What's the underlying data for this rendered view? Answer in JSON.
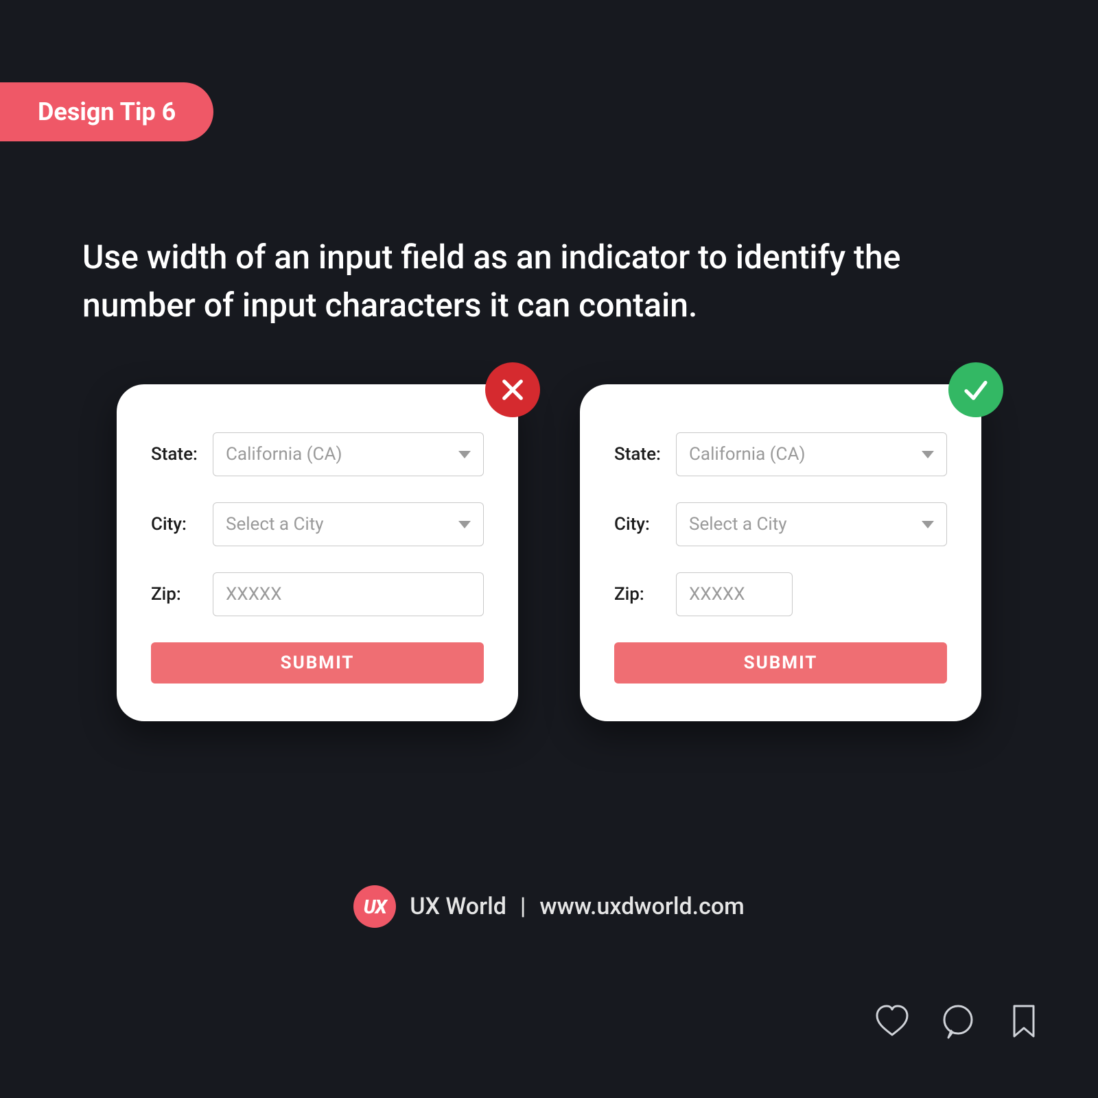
{
  "tag": "Design Tip 6",
  "headline": "Use width of an input field as an indicator to identify the number of input characters it can contain.",
  "bad": {
    "state_label": "State:",
    "state_value": "California (CA)",
    "city_label": "City:",
    "city_value": "Select a City",
    "zip_label": "Zip:",
    "zip_placeholder": "XXXXX",
    "submit": "SUBMIT"
  },
  "good": {
    "state_label": "State:",
    "state_value": "California (CA)",
    "city_label": "City:",
    "city_value": "Select a City",
    "zip_label": "Zip:",
    "zip_placeholder": "XXXXX",
    "submit": "SUBMIT"
  },
  "footer": {
    "badge": "UX",
    "brand": "UX World",
    "sep": "|",
    "url": "www.uxdworld.com"
  }
}
